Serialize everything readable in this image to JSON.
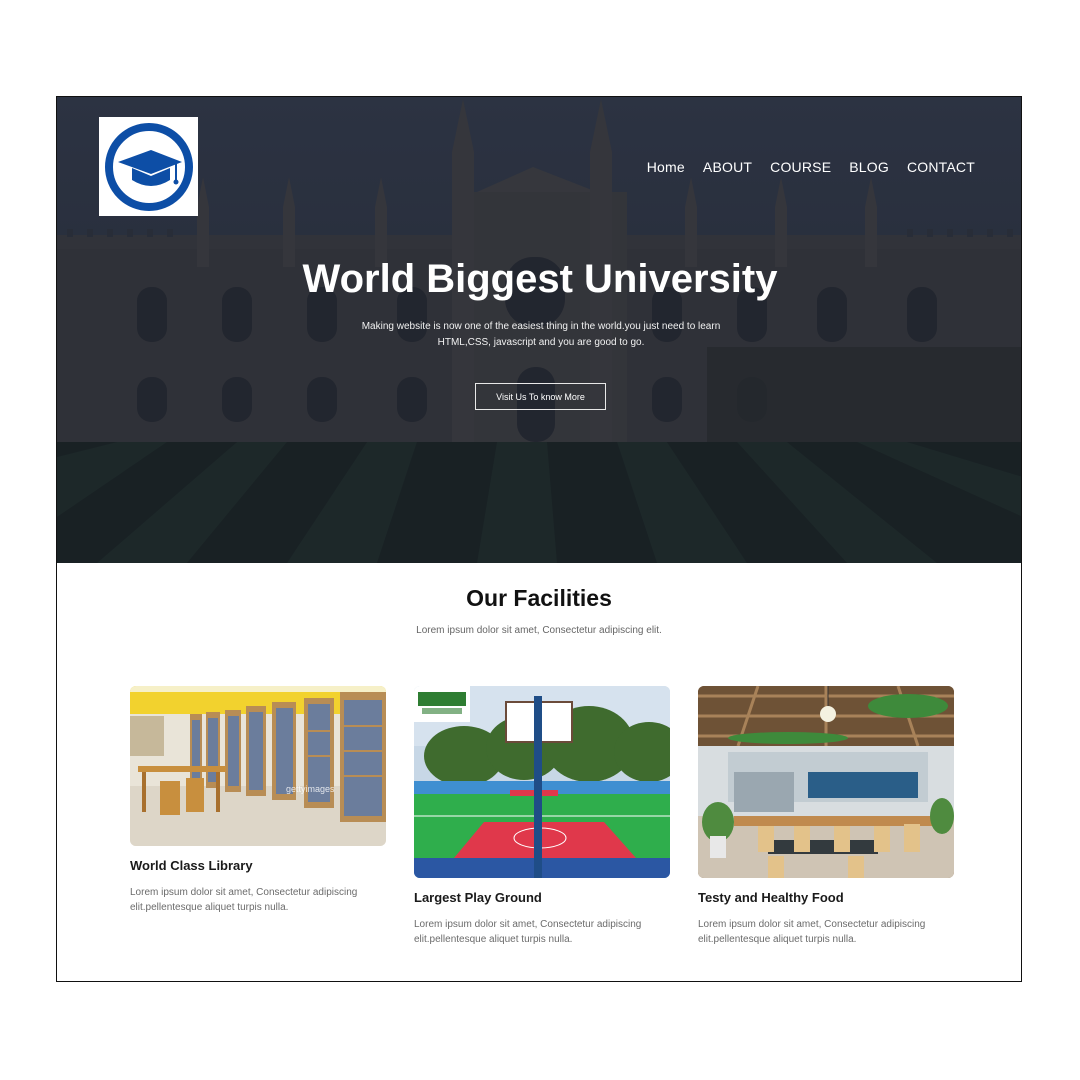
{
  "nav": {
    "items": [
      "Home",
      "ABOUT",
      "COURSE",
      "BLOG",
      "CONTACT"
    ]
  },
  "hero": {
    "title": "World Biggest University",
    "text": "Making website is now one of the easiest thing in the world.you just need to learn HTML,CSS, javascript and you are good to go.",
    "button": "Visit Us To know More"
  },
  "facilities": {
    "title": "Our Facilities",
    "subtitle": "Lorem ipsum dolor sit amet, Consectetur adipiscing elit.",
    "cards": [
      {
        "title": "World Class Library",
        "text": "Lorem ipsum dolor sit amet, Consectetur adipiscing elit.pellentesque aliquet turpis nulla.",
        "watermark": "gettyimages"
      },
      {
        "title": "Largest Play Ground",
        "text": "Lorem ipsum dolor sit amet, Consectetur adipiscing elit.pellentesque aliquet turpis nulla."
      },
      {
        "title": "Testy and Healthy Food",
        "text": "Lorem ipsum dolor sit amet, Consectetur adipiscing elit.pellentesque aliquet turpis nulla."
      }
    ]
  },
  "colors": {
    "logo_blue": "#0d4ea6",
    "hero_overlay": "#232a36"
  },
  "icons": [
    "graduation-cap-icon"
  ]
}
